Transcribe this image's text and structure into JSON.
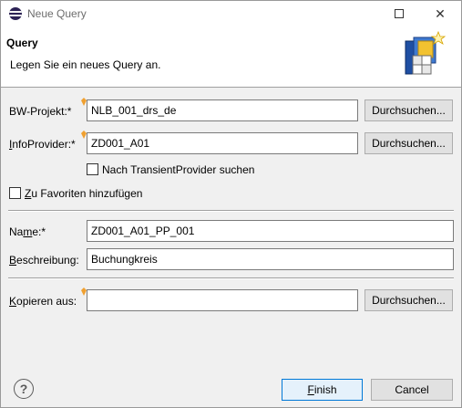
{
  "window": {
    "title": "Neue Query",
    "maximize_glyph": "",
    "close_glyph": "✕"
  },
  "header": {
    "title": "Query",
    "description": "Legen Sie ein neues Query an."
  },
  "form": {
    "bw_projekt": {
      "label": "BW-Projekt:*",
      "value": "NLB_001_drs_de",
      "button": "Durchsuchen..."
    },
    "infoprovider": {
      "label_mnemonic": "I",
      "label_rest": "nfoProvider:*",
      "value": "ZD001_A01",
      "button": "Durchsuchen..."
    },
    "transient_checkbox": {
      "label": "Nach TransientProvider suchen",
      "checked": false
    },
    "favoriten_checkbox": {
      "label_mnemonic": "Z",
      "label_rest": "u Favoriten hinzufügen",
      "checked": false
    },
    "name": {
      "label_pre": "Na",
      "label_mnemonic": "m",
      "label_post": "e:*",
      "value": "ZD001_A01_PP_001"
    },
    "beschreibung": {
      "label_mnemonic": "B",
      "label_rest": "eschreibung:",
      "value": "Buchungkreis"
    },
    "kopieren": {
      "label_mnemonic": "K",
      "label_rest": "opieren aus:",
      "value": "",
      "button": "Durchsuchen..."
    }
  },
  "footer": {
    "help_glyph": "?",
    "finish_mnemonic": "F",
    "finish_rest": "inish",
    "cancel": "Cancel"
  },
  "colors": {
    "accent": "#0078d7",
    "hint": "#f0a030"
  }
}
